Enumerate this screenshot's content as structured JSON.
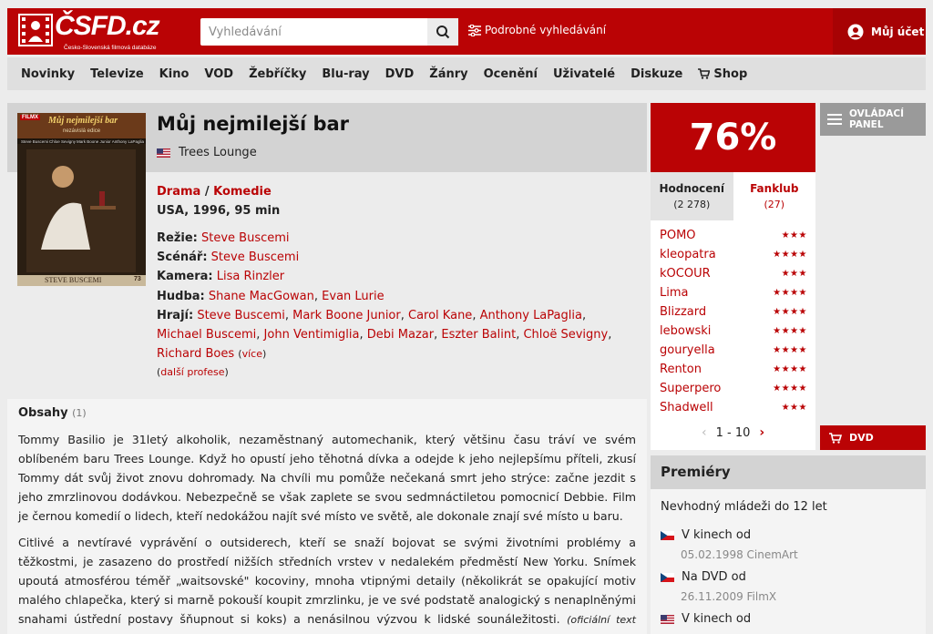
{
  "header": {
    "logo_text": "ČSFD.cz",
    "logo_sub": "Česko-Slovenská filmová databáze",
    "search_placeholder": "Vyhledávání",
    "advanced_search": "Podrobné vyhledávání",
    "account": "Můj účet"
  },
  "nav": [
    "Novinky",
    "Televize",
    "Kino",
    "VOD",
    "Žebříčky",
    "Blu-ray",
    "DVD",
    "Žánry",
    "Ocenění",
    "Uživatelé",
    "Diskuze",
    "Shop"
  ],
  "film": {
    "poster_label": "FILMX",
    "poster_title": "Můj nejmilejší bar",
    "poster_series": "nezávislá edice",
    "poster_director": "STEVE BUSCEMI",
    "poster_number": "73",
    "poster_cast": [
      "Steve Buscemi",
      "Chloe Sevigny",
      "Mark Boone Junior",
      "Anthony LaPaglia"
    ],
    "title": "Můj nejmilejší bar",
    "original_title": "Trees Lounge",
    "genre_1": "Drama",
    "genre_sep": "/",
    "genre_2": "Komedie",
    "origin": "USA, 1996, 95 min",
    "rezie_label": "Režie:",
    "rezie": "Steve Buscemi",
    "scenar_label": "Scénář:",
    "scenar": "Steve Buscemi",
    "kamera_label": "Kamera:",
    "kamera": "Lisa Rinzler",
    "hudba_label": "Hudba:",
    "hudba": [
      "Shane MacGowan",
      "Evan Lurie"
    ],
    "hraji_label": "Hrají:",
    "hraji": [
      "Steve Buscemi",
      "Mark Boone Junior",
      "Carol Kane",
      "Anthony LaPaglia",
      "Michael Buscemi",
      "John Ventimiglia",
      "Debi Mazar",
      "Eszter Balint",
      "Chloë Sevigny",
      "Richard Boes"
    ],
    "vice": "více",
    "dalsi_profese": "další profese"
  },
  "plot": {
    "title": "Obsahy",
    "count": "(1)",
    "para1": "Tommy Basilio je 31letý alkoholik, nezaměstnaný automechanik, který většinu času tráví ve svém oblíbeném baru Trees Lounge. Když ho opustí jeho těhotná dívka a odejde k jeho nejlepšímu příteli, zkusí Tommy dát svůj život znovu dohromady. Na chvíli mu pomůže nečekaná smrt jeho strýce: začne jezdit s jeho zmrzlinovou dodávkou. Nebezpečně se však zaplete se svou sedmnáctiletou pomocnicí Debbie. Film je černou komedií o lidech, kteří nedokážou najít své místo ve světě, ale dokonale znají své místo u baru.",
    "para2": "Citlivé a nevtíravé vyprávění o outsiderech, kteří se snaží bojovat se svými životními problémy a těžkostmi, je zasazeno do prostředí nižších středních vrstev v nedalekém předměstí New Yorku. Snímek upoutá atmosférou téměř „waitsovské\" kocoviny, mnoha vtipnými detaily (několikrát se opakující motiv malého chlapečka, který si marně pokouší koupit zmrzlinku, je ve své podstatě analogický s nenaplněnými snahami ústřední postavy šňupnout si koks) a nenásilnou výzvou k lidské sounáležitosti.",
    "source": "(oficiální text distributora)"
  },
  "rating": {
    "score": "76%",
    "tab_ratings": "Hodnocení",
    "tab_ratings_count": "(2 278)",
    "tab_fanclub": "Fanklub",
    "tab_fanclub_count": "(27)",
    "users": [
      {
        "name": "POMO",
        "stars": 3
      },
      {
        "name": "kleopatra",
        "stars": 4
      },
      {
        "name": "kOCOUR",
        "stars": 3
      },
      {
        "name": "Lima",
        "stars": 4
      },
      {
        "name": "Blizzard",
        "stars": 4
      },
      {
        "name": "lebowski",
        "stars": 4
      },
      {
        "name": "gouryella",
        "stars": 4
      },
      {
        "name": "Renton",
        "stars": 4
      },
      {
        "name": "Superpero",
        "stars": 4
      },
      {
        "name": "Shadwell",
        "stars": 3
      }
    ],
    "pager": "1 - 10"
  },
  "sidebar": {
    "control_panel_1": "OVLÁDACÍ",
    "control_panel_2": "PANEL",
    "dvd": "DVD"
  },
  "premieres": {
    "title": "Premiéry",
    "age": "Nevhodný mládeži do 12 let",
    "items": [
      {
        "label": "V kinech od",
        "detail": "05.02.1998 CinemArt"
      },
      {
        "label": "Na DVD od",
        "detail": "26.11.2009 FilmX"
      },
      {
        "label": "V kinech od",
        "detail": ""
      }
    ]
  },
  "colors": {
    "accent": "#ba0305",
    "header_dark": "#a70204"
  }
}
